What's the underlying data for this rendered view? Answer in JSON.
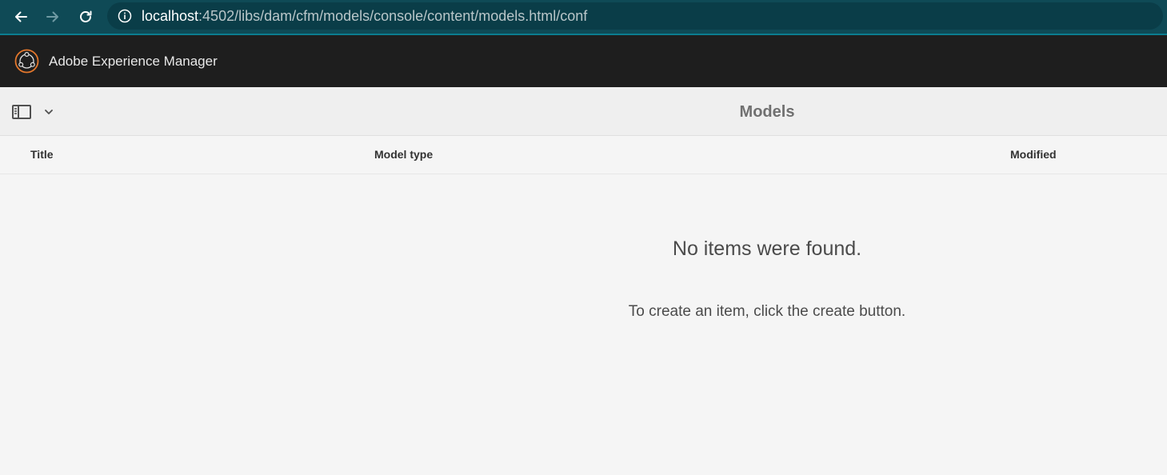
{
  "browser": {
    "url_host": "localhost",
    "url_rest": ":4502/libs/dam/cfm/models/console/content/models.html/conf",
    "icons": {
      "back": "arrow-left-icon",
      "forward": "arrow-right-icon",
      "reload": "reload-icon",
      "site_info": "info-icon"
    }
  },
  "shell": {
    "product_name": "Adobe Experience Manager",
    "logo": "aem-logo-icon",
    "logo_color": "#e3772c"
  },
  "action_bar": {
    "rail_toggle_icon": "rail-toggle-icon",
    "rail_toggle_chevron": "chevron-down-icon",
    "title": "Models"
  },
  "table": {
    "columns": [
      "Title",
      "Model type",
      "Modified"
    ]
  },
  "empty_state": {
    "heading": "No items were found.",
    "message": "To create an item, click the create button."
  },
  "colors": {
    "browser_bar": "#0f4a56",
    "shell_header": "#1e1e1e",
    "content_bg": "#f5f5f5"
  }
}
